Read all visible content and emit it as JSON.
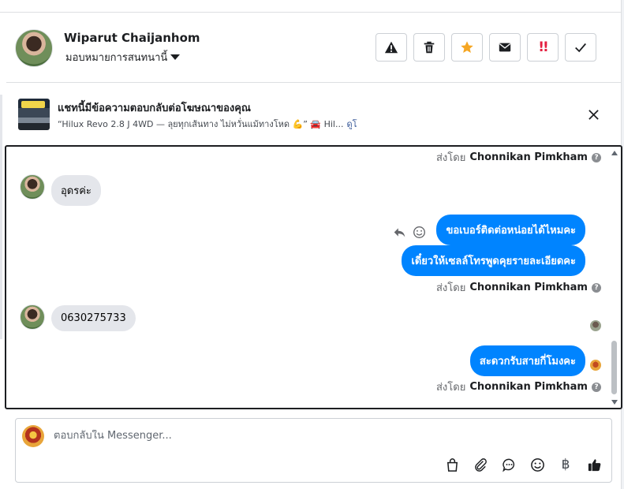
{
  "header": {
    "user_name": "Wiparut Chaijanhom",
    "assign_label": "มอบหมายการสนทนานี้",
    "actions": [
      "warning-icon",
      "trash-icon",
      "star-icon",
      "envelope-icon",
      "priority-icon",
      "check-icon"
    ],
    "priority_text": "!!",
    "colors": {
      "star": "#f5a623",
      "priority": "#e41e3f"
    }
  },
  "ad": {
    "title": "แชทนี้มีข้อความตอบกลับต่อโฆษณาของคุณ",
    "description": "“Hilux Revo 2.8 J 4WD — ลุยทุกเส้นทาง ไม่หวั่นแม้ทางโหด 💪” 🚘 Hil...",
    "link": "ดูโฆษณา"
  },
  "chat": {
    "sent_by_prefix": "ส่งโดย",
    "agent_name": "Chonnikan Pimkham",
    "incoming": [
      {
        "text": "อุดรค่ะ"
      },
      {
        "text": "0630275733"
      }
    ],
    "outgoing": [
      {
        "text": "ขอเบอร์ติดต่อหน่อยได้ไหมคะ"
      },
      {
        "text": "เดี๋ยวให้เซลล์โทรพูดคุยรายละเอียดคะ"
      },
      {
        "text": "สะดวกรับสายกี่โมงคะ"
      }
    ],
    "colors": {
      "outgoing_bubble": "#0084ff",
      "incoming_bubble": "#e4e6eb"
    }
  },
  "composer": {
    "placeholder": "ตอบกลับใน Messenger...",
    "tools": [
      "shopping-bag-icon",
      "paperclip-icon",
      "chat-bubble-icon",
      "smiley-icon",
      "baht-icon",
      "thumbs-up-icon"
    ],
    "baht_symbol": "฿"
  }
}
